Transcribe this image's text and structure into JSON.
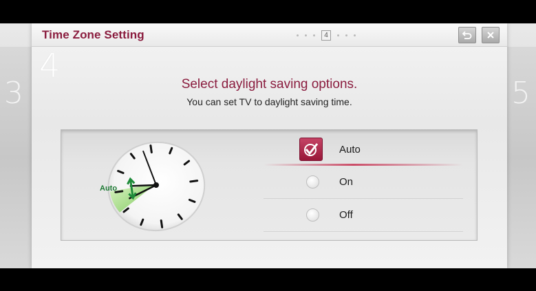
{
  "window": {
    "title": "Time Zone Setting",
    "current_step": "4",
    "prev_step": "3",
    "next_step": "5"
  },
  "main": {
    "heading": "Select daylight saving options.",
    "subheading": "You can set TV to daylight saving time."
  },
  "clock": {
    "label": "Auto"
  },
  "options": [
    {
      "label": "Auto",
      "selected": true
    },
    {
      "label": "On",
      "selected": false
    },
    {
      "label": "Off",
      "selected": false
    }
  ],
  "colors": {
    "accent": "#8a1c3e",
    "selection": "#b32a4f"
  },
  "icons": {
    "back": "back-arrow-icon",
    "close": "close-icon",
    "check": "checkmark-icon"
  }
}
